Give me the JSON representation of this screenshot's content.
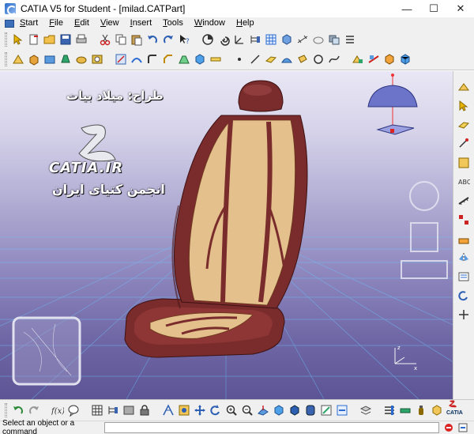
{
  "window": {
    "title": "CATIA V5 for Student - [milad.CATPart]",
    "minimize": "—",
    "maximize": "☐",
    "close": "✕"
  },
  "menu": {
    "items": [
      {
        "label": "Start",
        "key": "S",
        "rest": "tart"
      },
      {
        "label": "File",
        "key": "F",
        "rest": "ile"
      },
      {
        "label": "Edit",
        "key": "E",
        "rest": "dit"
      },
      {
        "label": "View",
        "key": "V",
        "rest": "iew"
      },
      {
        "label": "Insert",
        "key": "I",
        "rest": "nsert"
      },
      {
        "label": "Tools",
        "key": "T",
        "rest": "ools"
      },
      {
        "label": "Window",
        "key": "W",
        "rest": "indow"
      },
      {
        "label": "Help",
        "key": "H",
        "rest": "elp"
      }
    ]
  },
  "watermark": {
    "designer": "طراح: میلاد بیات",
    "brand": "CATIA.IR",
    "community": "انجمن کتیای ایران"
  },
  "logo": {
    "text": "CATIA"
  },
  "status": {
    "prompt": "Select an object or a command"
  },
  "colors": {
    "seat_frame": "#7a2b2b",
    "seat_insert": "#e3c08c",
    "background_top": "#e9e7f4",
    "background_bottom": "#5c5494",
    "toolbar": "#f0f0f0"
  },
  "toolbars": {
    "top1": [
      "select-icon",
      "new-icon",
      "open-icon",
      "save-icon",
      "print-icon",
      "cut-icon",
      "copy-icon",
      "paste-icon",
      "undo-icon",
      "redo-icon",
      "whats-this-icon"
    ],
    "top2": [
      "sketch-icon",
      "pad-icon",
      "pocket-icon",
      "shaft-icon",
      "groove-icon",
      "hole-icon",
      "rib-icon",
      "slot-icon",
      "fillet-icon",
      "chamfer-icon"
    ],
    "right": [
      "sketcher-icon",
      "arrow-icon",
      "plane-icon",
      "point-icon",
      "line-icon",
      "text-icon",
      "measure-icon",
      "pattern-icon"
    ],
    "bottom": [
      "undo-icon",
      "redo-icon",
      "formula-icon",
      "help-icon",
      "table-icon",
      "tree-icon",
      "fly-icon",
      "fit-all-icon",
      "pan-icon",
      "rotate-icon",
      "zoom-in-icon",
      "zoom-out-icon",
      "normal-view-icon",
      "iso-view-icon",
      "shading-icon",
      "hide-show-icon",
      "swap-icon",
      "measure-icon"
    ]
  }
}
